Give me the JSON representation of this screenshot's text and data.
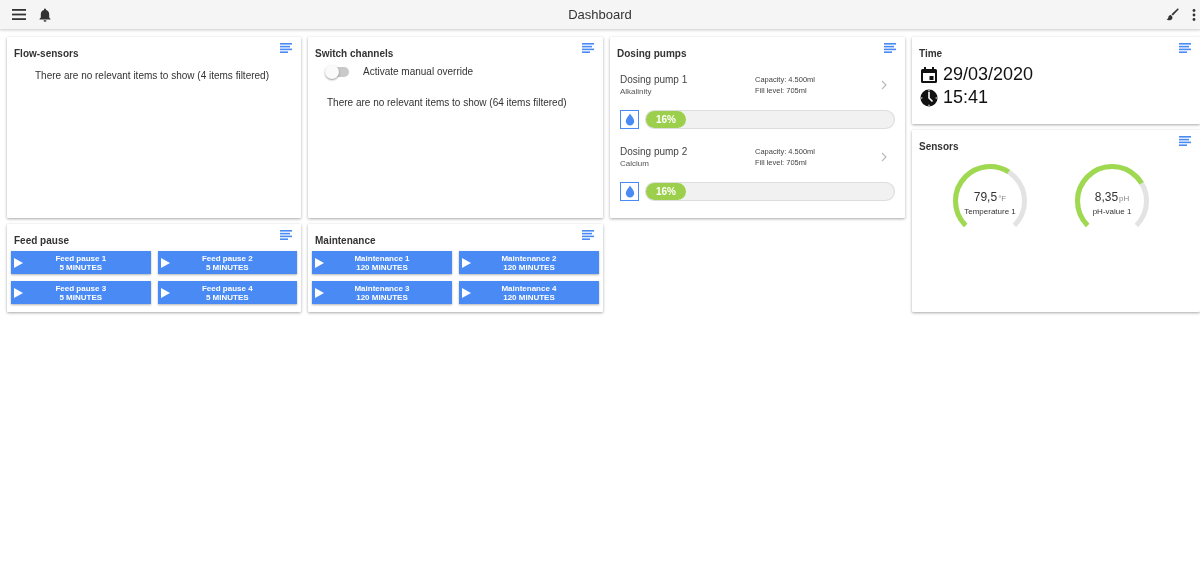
{
  "header": {
    "title": "Dashboard"
  },
  "cards": [
    {
      "kind": "empty",
      "title": "Flow-sensors",
      "message": "There are no relevant items to show (4 items filtered)"
    },
    {
      "kind": "switch",
      "title": "Switch channels",
      "toggle": {
        "label": "Activate manual override",
        "on": false
      },
      "message": "There are no relevant items to show (64 items filtered)"
    },
    {
      "kind": "pumps",
      "title": "Dosing pumps",
      "pumps": [
        {
          "name": "Dosing pump 1",
          "subtitle": "Alkalinity",
          "capacity": "Capacity: 4.500ml",
          "fill": "Fill level: 705ml",
          "level": 0.16,
          "reading": "16%"
        },
        {
          "name": "Dosing pump 2",
          "subtitle": "Calcium",
          "capacity": "Capacity: 4.500ml",
          "fill": "Fill level: 705ml",
          "level": 0.16,
          "reading": "16%"
        }
      ]
    },
    {
      "kind": "time",
      "title": "Time",
      "date": "29/03/2020",
      "time": "15:41"
    },
    {
      "kind": "buttons",
      "title": "Feed pause",
      "buttons": [
        {
          "label": "Feed pause 1",
          "duration": "5 MINUTES"
        },
        {
          "label": "Feed pause 2",
          "duration": "5 MINUTES"
        },
        {
          "label": "Feed pause 3",
          "duration": "5 MINUTES"
        },
        {
          "label": "Feed pause 4",
          "duration": "5 MINUTES"
        }
      ]
    },
    {
      "kind": "buttons",
      "title": "Maintenance",
      "buttons": [
        {
          "label": "Maintenance 1",
          "duration": "120 MINUTES"
        },
        {
          "label": "Maintenance 2",
          "duration": "120 MINUTES"
        },
        {
          "label": "Maintenance 3",
          "duration": "120 MINUTES"
        },
        {
          "label": "Maintenance 4",
          "duration": "120 MINUTES"
        }
      ]
    },
    {
      "kind": "gauges",
      "title": "Sensors",
      "gauges": [
        {
          "value": "79,5",
          "unit": "°F",
          "label": "Temperature 1"
        },
        {
          "value": "8,35",
          "unit": "pH",
          "label": "pH-value 1"
        }
      ]
    }
  ]
}
